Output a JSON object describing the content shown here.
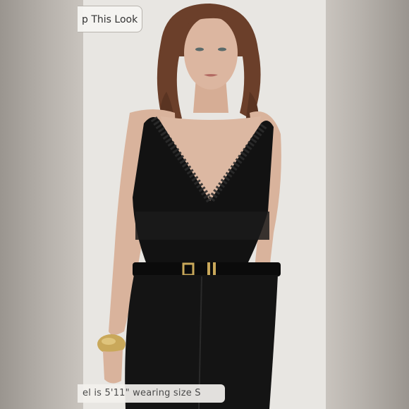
{
  "overlay": {
    "shop_button_label": "p This Look",
    "model_caption": "el is 5'11\" wearing size S"
  },
  "colors": {
    "backdrop": "#e8e6e2",
    "side_panel": "#b8b3ad",
    "garment": "#111111",
    "skin": "#d9b39c",
    "hair": "#6b3f2a",
    "belt_buckle": "#c9a85a"
  },
  "icons": {
    "cuff_bracelet": "gold-cuff-icon"
  }
}
